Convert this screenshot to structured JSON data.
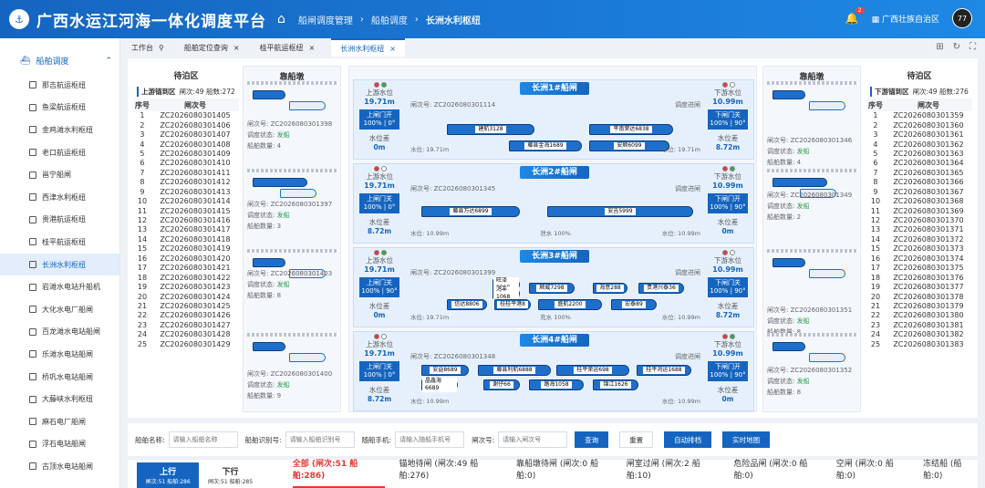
{
  "header": {
    "title": "广西水运江河海一体化调度平台",
    "breadcrumb": [
      "船闸调度管理",
      "船舶调度",
      "长洲水利枢纽"
    ],
    "bell_count": "2",
    "org": "广西壮族自治区",
    "avatar": "77"
  },
  "sidebar": {
    "group": "船舶调度",
    "items": [
      "那吉航运枢纽",
      "鱼梁航运枢纽",
      "金鸡滩水利枢纽",
      "老口航运枢纽",
      "邕宁船闸",
      "西津水利枢纽",
      "贵港航运枢纽",
      "桂平航运枢纽",
      "长洲水利枢纽",
      "岩滩水电站升船机",
      "大化水电厂船闸",
      "百龙滩水电站船闸",
      "乐滩水电站船闸",
      "桥巩水电站船闸",
      "大藤峡水利枢纽",
      "麻石电厂船闸",
      "浮石电站船闸",
      "古顶水电站船闸"
    ]
  },
  "tabs": [
    "工作台",
    "船舶定位查询",
    "桂平航运枢纽",
    "长洲水利枢纽"
  ],
  "left_wait": {
    "title": "待泊区",
    "sub_label": "上游锚到区",
    "sub_stats": "闸次:49 船数:272",
    "col1": "序号",
    "col2": "闸次号",
    "rows": [
      [
        "1",
        "ZC2026080301405"
      ],
      [
        "2",
        "ZC2026080301406"
      ],
      [
        "3",
        "ZC2026080301407"
      ],
      [
        "4",
        "ZC2026080301408"
      ],
      [
        "5",
        "ZC2026080301409"
      ],
      [
        "6",
        "ZC2026080301410"
      ],
      [
        "7",
        "ZC2026080301411"
      ],
      [
        "8",
        "ZC2026080301412"
      ],
      [
        "9",
        "ZC2026080301413"
      ],
      [
        "10",
        "ZC2026080301414"
      ],
      [
        "11",
        "ZC2026080301415"
      ],
      [
        "12",
        "ZC2026080301416"
      ],
      [
        "13",
        "ZC2026080301417"
      ],
      [
        "14",
        "ZC2026080301418"
      ],
      [
        "15",
        "ZC2026080301419"
      ],
      [
        "16",
        "ZC2026080301420"
      ],
      [
        "17",
        "ZC2026080301421"
      ],
      [
        "18",
        "ZC2026080301422"
      ],
      [
        "19",
        "ZC2026080301423"
      ],
      [
        "20",
        "ZC2026080301424"
      ],
      [
        "21",
        "ZC2026080301425"
      ],
      [
        "22",
        "ZC2026080301426"
      ],
      [
        "23",
        "ZC2026080301427"
      ],
      [
        "24",
        "ZC2026080301428"
      ],
      [
        "25",
        "ZC2026080301429"
      ]
    ]
  },
  "right_wait": {
    "title": "待泊区",
    "sub_label": "下游锚到区",
    "sub_stats": "闸次:49 船数:276",
    "col1": "序号",
    "col2": "闸次号",
    "rows": [
      [
        "1",
        "ZC2026080301359"
      ],
      [
        "2",
        "ZC2026080301360"
      ],
      [
        "3",
        "ZC2026080301361"
      ],
      [
        "4",
        "ZC2026080301362"
      ],
      [
        "5",
        "ZC2026080301363"
      ],
      [
        "6",
        "ZC2026080301364"
      ],
      [
        "7",
        "ZC2026080301365"
      ],
      [
        "8",
        "ZC2026080301366"
      ],
      [
        "9",
        "ZC2026080301367"
      ],
      [
        "10",
        "ZC2026080301368"
      ],
      [
        "11",
        "ZC2026080301369"
      ],
      [
        "12",
        "ZC2026080301370"
      ],
      [
        "13",
        "ZC2026080301371"
      ],
      [
        "14",
        "ZC2026080301372"
      ],
      [
        "15",
        "ZC2026080301373"
      ],
      [
        "16",
        "ZC2026080301374"
      ],
      [
        "17",
        "ZC2026080301375"
      ],
      [
        "18",
        "ZC2026080301376"
      ],
      [
        "19",
        "ZC2026080301377"
      ],
      [
        "20",
        "ZC2026080301378"
      ],
      [
        "21",
        "ZC2026080301379"
      ],
      [
        "22",
        "ZC2026080301380"
      ],
      [
        "23",
        "ZC2026080301381"
      ],
      [
        "24",
        "ZC2026080301382"
      ],
      [
        "25",
        "ZC2026080301383"
      ]
    ]
  },
  "left_berth": {
    "title": "靠船墩",
    "groups": [
      {
        "id": "闸次号: ZC2026080301398",
        "status_label": "调度状态:",
        "status": "发船",
        "count": "船舶数量: 4"
      },
      {
        "id": "闸次号: ZC2026080301397",
        "status_label": "调度状态:",
        "status": "发船",
        "count": "船舶数量: 3"
      },
      {
        "id": "闸次号: ZC2026080301403",
        "status_label": "调度状态:",
        "status": "发船",
        "count": "船舶数量: 8"
      },
      {
        "id": "闸次号: ZC2026080301400",
        "status_label": "调度状态:",
        "status": "发船",
        "count": "船舶数量: 9"
      }
    ]
  },
  "right_berth": {
    "title": "靠船墩",
    "groups": [
      {
        "id": "闸次号: ZC2026080301346",
        "status_label": "调度状态:",
        "status": "发船",
        "count": "船舶数量: 4"
      },
      {
        "id": "闸次号: ZC2026080301349",
        "status_label": "调度状态:",
        "status": "发船",
        "count": "船舶数量: 2"
      },
      {
        "id": "闸次号: ZC2026080301351",
        "status_label": "调度状态:",
        "status": "发船",
        "count": "船舶数量: 8"
      },
      {
        "id": "闸次号: ZC2026080301352",
        "status_label": "调度状态:",
        "status": "发船",
        "count": "船舶数量: 8"
      }
    ]
  },
  "locks": [
    {
      "name": "长洲1#船闸",
      "up_label": "上游水位",
      "up_level": "19.71m",
      "up_gate": "上闸门开",
      "up_pct": "100% | 0°",
      "up_diff_label": "水位差",
      "up_diff": "0m",
      "down_label": "下游水位",
      "down_level": "10.99m",
      "down_gate": "下闸门关",
      "down_pct": "100% | 90°",
      "down_diff_label": "水位差",
      "down_diff": "8.72m",
      "chamber_id": "闸次号: ZC2026080301114",
      "chamber_status": "调度进闸",
      "foot_left": "水位: 19.71m",
      "foot_mid": "",
      "foot_right": "水位: 19.71m",
      "ships": [
        "建航3128",
        "平南荣达6838",
        "藤县金海1689",
        "安顺6099"
      ]
    },
    {
      "name": "长洲2#船闸",
      "up_label": "上游水位",
      "up_level": "19.71m",
      "up_gate": "上闸门关",
      "up_pct": "100% | 0°",
      "up_diff_label": "水位差",
      "up_diff": "8.72m",
      "down_label": "下游水位",
      "down_level": "10.99m",
      "down_gate": "下闸门开",
      "down_pct": "100% | 90°",
      "down_diff_label": "水位差",
      "down_diff": "0m",
      "chamber_id": "闸次号: ZC2026080301345",
      "chamber_status": "调度进闸",
      "foot_left": "水位: 10.99m",
      "foot_mid": "泄水 100%",
      "foot_right": "水位: 10.99m",
      "ships": [
        "藤县万达6899",
        "安吉5999"
      ]
    },
    {
      "name": "长洲3#船闸",
      "up_label": "上游水位",
      "up_level": "19.71m",
      "up_gate": "上闸门关",
      "up_pct": "100% | 90°",
      "up_diff_label": "水位差",
      "up_diff": "0m",
      "down_label": "下游水位",
      "down_level": "10.99m",
      "down_gate": "下闸门关",
      "down_pct": "100% | 90°",
      "down_diff_label": "水位差",
      "down_diff": "8.72m",
      "chamber_id": "闸次号: ZC2026080301399",
      "chamber_status": "调度进闸",
      "foot_left": "水位: 19.71m",
      "foot_mid": "充水 100%",
      "foot_right": "水位: 10.99m",
      "ships": [
        "旺泽8968",
        "鸿丰1068",
        "顺威7298",
        "海意288",
        "贵港兴泰36",
        "信达8806",
        "桂桂平港8",
        "盛航2200",
        "宏泰89"
      ]
    },
    {
      "name": "长洲4#船闸",
      "up_label": "上游水位",
      "up_level": "19.71m",
      "up_gate": "上闸门关",
      "up_pct": "100% | 0°",
      "up_diff_label": "水位差",
      "up_diff": "8.72m",
      "down_label": "下游水位",
      "down_level": "10.99m",
      "down_gate": "下闸门开",
      "down_pct": "100% | 90°",
      "down_diff_label": "水位差",
      "down_diff": "0m",
      "chamber_id": "闸次号: ZC2026080301348",
      "chamber_status": "调度进闸",
      "foot_left": "水位: 10.99m",
      "foot_mid": "",
      "foot_right": "水位: 10.99m",
      "ships": [
        "安益8689",
        "藤县利航6888",
        "桂平荣运698",
        "桂平鸿运1688",
        "晶鑫海6689",
        "谢仔66",
        "路海1058",
        "锦江1626"
      ]
    }
  ],
  "filter": {
    "name_label": "船舶名称:",
    "name_ph": "请输入船舶名称",
    "id_label": "船舶识别号:",
    "id_ph": "请输入船舶识别号",
    "phone_label": "随船手机:",
    "phone_ph": "请输入随船手机号",
    "lock_label": "闸次号:",
    "lock_ph": "请输入闸次号",
    "btn_query": "查询",
    "btn_reset": "重置",
    "btn_auto": "自动排档",
    "btn_map": "实时地图"
  },
  "bottom": {
    "up": "上行",
    "up_stats": "闸次:51 船舶:286",
    "down": "下行",
    "down_stats": "闸次:51 船舶:285",
    "stats": [
      "全部 (闸次:51 船舶:286)",
      "锚地待闸 (闸次:49 船舶:276)",
      "靠船墩待闸 (闸次:0 船舶:0)",
      "闸室过闸 (闸次:2 船舶:10)",
      "危险品闸 (闸次:0 船舶:0)",
      "空闸 (闸次:0 船舶:0)",
      "冻结船 (船舶:0)"
    ]
  }
}
